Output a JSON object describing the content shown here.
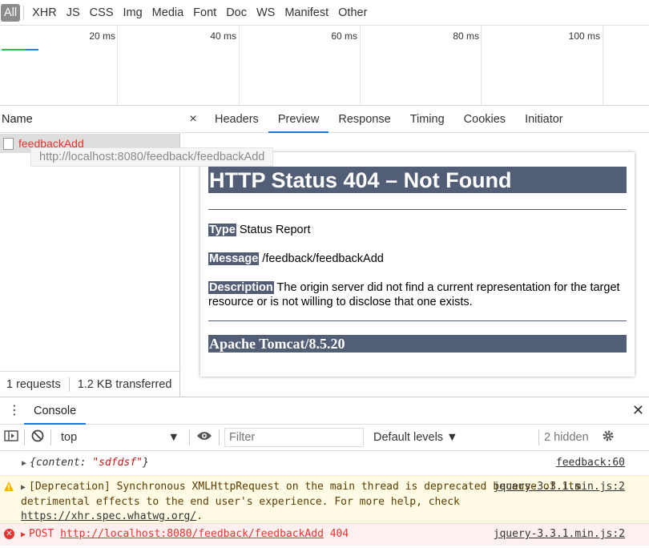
{
  "filter_types": [
    "All",
    "XHR",
    "JS",
    "CSS",
    "Img",
    "Media",
    "Font",
    "Doc",
    "WS",
    "Manifest",
    "Other"
  ],
  "timeline": {
    "labels": [
      "20 ms",
      "40 ms",
      "60 ms",
      "80 ms",
      "100 ms"
    ]
  },
  "request_list": {
    "header": "Name",
    "rows": [
      {
        "name": "feedbackAdd",
        "status_color": "#e3342f"
      }
    ],
    "tooltip": "http://localhost:8080/feedback/feedbackAdd",
    "requests_count": "1 requests",
    "transferred": "1.2 KB transferred"
  },
  "detail_tabs": {
    "close": "×",
    "tabs": [
      "Headers",
      "Preview",
      "Response",
      "Timing",
      "Cookies",
      "Initiator"
    ],
    "active": "Preview"
  },
  "preview": {
    "title": "HTTP Status 404 – Not Found",
    "type_label": "Type",
    "type_value": "Status Report",
    "message_label": "Message",
    "message_value": "/feedback/feedbackAdd",
    "description_label": "Description",
    "description_value": "The origin server did not find a current representation for the target resource or is not willing to disclose that one exists.",
    "footer": "Apache Tomcat/8.5.20"
  },
  "drawer": {
    "tab": "Console",
    "close": "✕"
  },
  "console_toolbar": {
    "context": "top",
    "filter_placeholder": "Filter",
    "levels": "Default levels ▼",
    "hidden": "2 hidden"
  },
  "messages": {
    "log": {
      "text_pre": "{content: ",
      "text_str": "\"sdfdsf\"",
      "text_post": "}",
      "source": "feedback:60"
    },
    "warning": {
      "text": "[Deprecation] Synchronous XMLHttpRequest on the main thread is deprecated because of its detrimental effects to the end user's experience. For more help, check ",
      "link": "https://xhr.spec.whatwg.org/",
      "tail": ".",
      "source": "jquery-3.3.1.min.js:2"
    },
    "error": {
      "method": "POST",
      "url": "http://localhost:8080/feedback/feedbackAdd",
      "code": "404",
      "source": "jquery-3.3.1.min.js:2"
    }
  },
  "colors": {
    "accent": "#1a73e8",
    "error": "#e3342f",
    "tomcat": "#525d76",
    "warning_bg": "#fffbe5"
  }
}
